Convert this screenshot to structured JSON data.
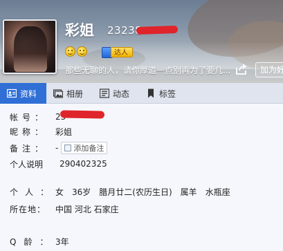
{
  "header": {
    "nickname": "彩姐",
    "qq_number": "23238",
    "badge_label": "达人",
    "signature": "那些无聊的人，请你厚道一点别再为了要几...",
    "add_friend_label": "加为好友"
  },
  "tabs": [
    {
      "label": "资料",
      "icon": "profile-card-icon"
    },
    {
      "label": "相册",
      "icon": "photo-album-icon"
    },
    {
      "label": "动态",
      "icon": "feed-icon"
    },
    {
      "label": "标签",
      "icon": "bookmark-icon"
    }
  ],
  "info": {
    "account_label": "帐号：",
    "account_value": "23",
    "nickname_label": "昵称：",
    "nickname_value": "彩姐",
    "remark_label": "备注：",
    "remark_value": "-",
    "add_remark_label": "添加备注",
    "personal_desc_label": "个人说明",
    "personal_desc_value": "290402325",
    "person_label": "个人：",
    "gender": "女",
    "age": "36岁",
    "birthday": "腊月廿二(农历生日)",
    "zodiac": "属羊",
    "constellation": "水瓶座",
    "location_label": "所在地：",
    "location": "中国 河北 石家庄",
    "qq_age_label": "Q龄：",
    "qq_age": "3年"
  },
  "colors": {
    "tab_active": "#2f6fd6",
    "redaction": "#e0242b"
  }
}
